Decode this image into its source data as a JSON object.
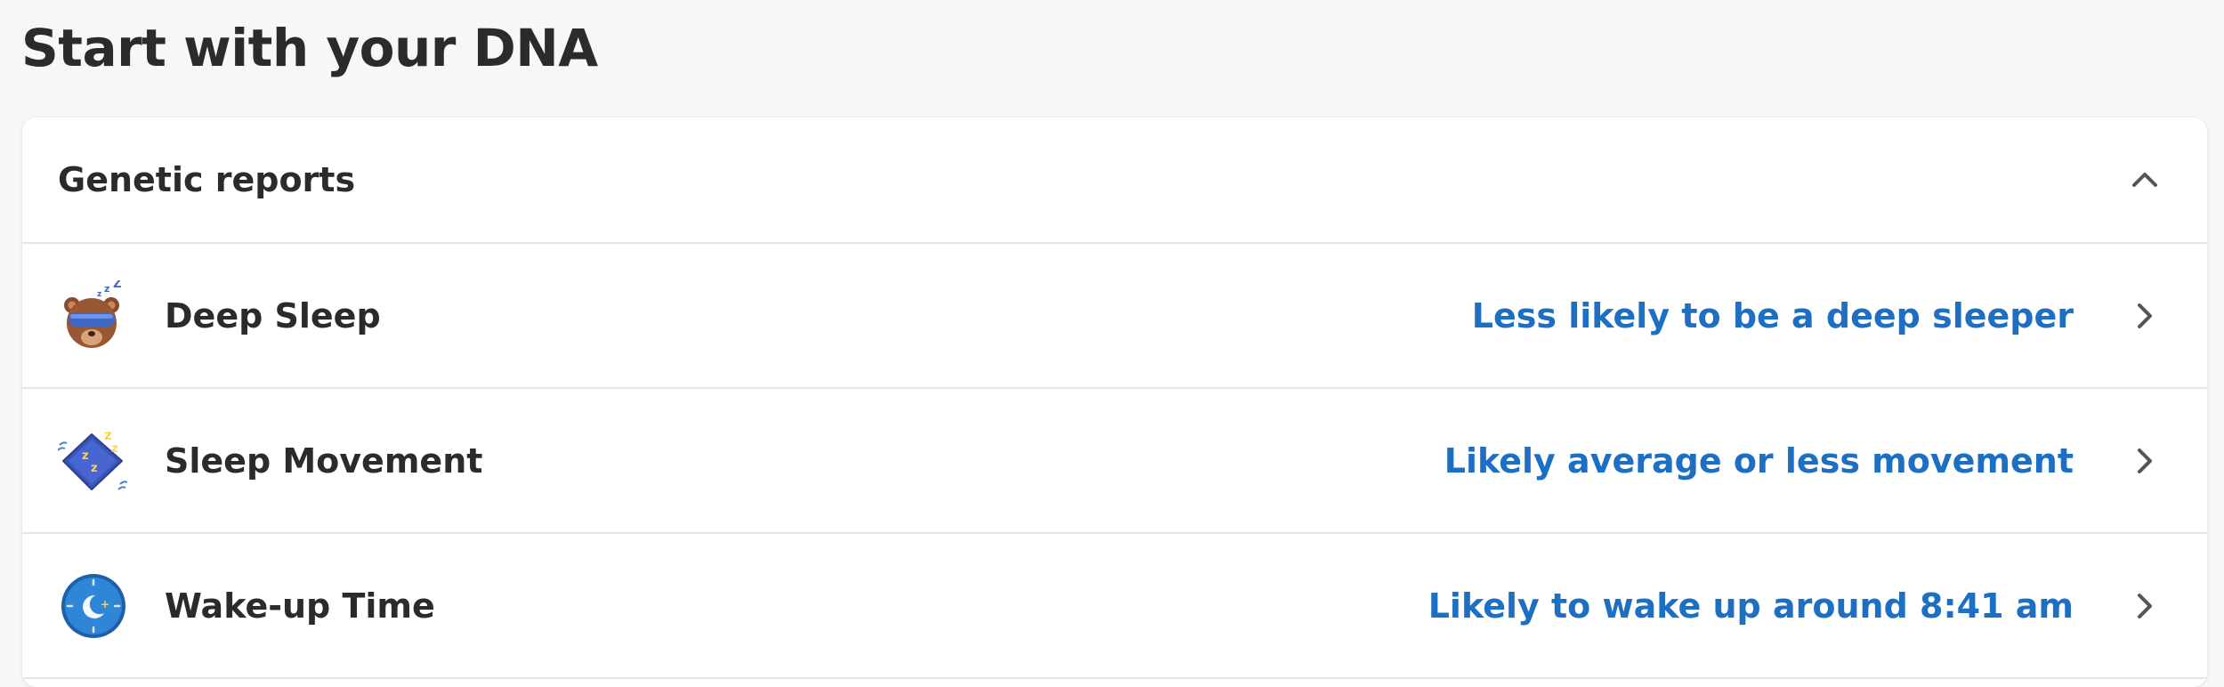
{
  "page": {
    "title": "Start with your DNA"
  },
  "card": {
    "title": "Genetic reports",
    "collapse_icon": "chevron-up-icon"
  },
  "reports": [
    {
      "title": "Deep Sleep",
      "result": "Less likely to be a deep sleeper",
      "icon": "sleeping-bear-icon"
    },
    {
      "title": "Sleep Movement",
      "result": "Likely average or less movement",
      "icon": "sleeping-pillow-icon"
    },
    {
      "title": "Wake-up Time",
      "result": "Likely to wake up around 8:41 am",
      "icon": "night-clock-icon"
    }
  ],
  "colors": {
    "accent": "#1d6fc4",
    "text": "#2b2b2b",
    "background": "#f6f7f9",
    "divider": "#e4e5e8"
  }
}
